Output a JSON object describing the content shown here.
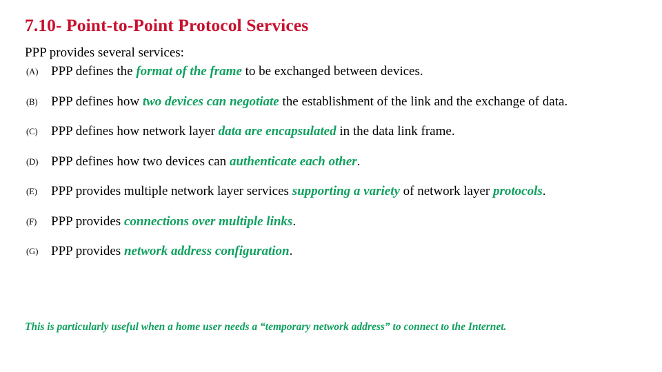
{
  "slide": {
    "title": "7.10- Point-to-Point Protocol Services",
    "title_color": "#c8102e",
    "emphasis_color": "#10a05f",
    "text_color": "#000000",
    "background_color": "#ffffff",
    "intro": "PPP provides several services:",
    "items": [
      {
        "marker": "(A)",
        "pre": "PPP defines the ",
        "emphasis": "format of the frame",
        "post": " to be exchanged between devices."
      },
      {
        "marker": "(B)",
        "pre": "PPP defines how ",
        "emphasis": "two devices can negotiate",
        "post": " the establishment of the link and the exchange of data."
      },
      {
        "marker": "(C)",
        "pre": "PPP defines how network layer ",
        "emphasis": "data are encapsulated",
        "post": " in the data link frame."
      },
      {
        "marker": "(D)",
        "pre": "PPP defines how two devices can ",
        "emphasis": "authenticate each other",
        "post": "."
      },
      {
        "marker": "(E)",
        "pre": "PPP provides multiple network layer services ",
        "emphasis": "supporting a variety",
        "mid": " of network layer ",
        "emphasis2": "protocols",
        "post": "."
      },
      {
        "marker": "(F)",
        "pre": "PPP provides ",
        "emphasis": "connections over multiple links",
        "post": "."
      },
      {
        "marker": "(G)",
        "pre": "PPP provides ",
        "emphasis": "network address configuration",
        "post": "."
      }
    ],
    "note": "This is particularly useful when a home user needs a “temporary network address” to connect to the Internet."
  }
}
